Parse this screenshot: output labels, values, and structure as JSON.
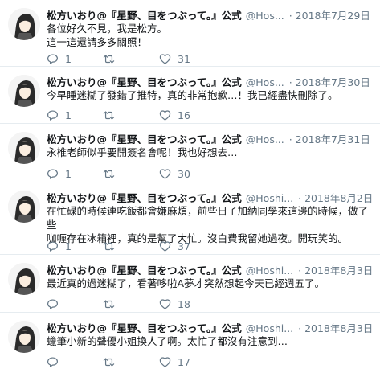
{
  "tweets": [
    {
      "name": "松方いおり@『星野、目をつぶって。』公式",
      "handle": "@Hos...",
      "date": "2018年7月29日",
      "lines": [
        "各位好久不見，我是松方。",
        "這一這還請多多關照！"
      ],
      "replies": "1",
      "retweets": "",
      "likes": "31"
    },
    {
      "name": "松方いおり@『星野、目をつぶって。』公式",
      "handle": "@Hos...",
      "date": "2018年7月30日",
      "lines": [
        "今早睡迷糊了發錯了推特，真的非常抱歉…！我已經盡快刪除了。"
      ],
      "replies": "1",
      "retweets": "",
      "likes": "16"
    },
    {
      "name": "松方いおり@『星野、目をつぶって。』公式",
      "handle": "@Hos...",
      "date": "2018年7月31日",
      "lines": [
        "永椎老師似乎要開簽名會呢！我也好想去…"
      ],
      "replies": "1",
      "retweets": "",
      "likes": "30"
    },
    {
      "name": "松方いおり@『星野、目をつぶって。』公式",
      "handle": "@Hoshi...",
      "date": "2018年8月2日",
      "lines": [
        "在忙碌的時候連吃飯都會嫌麻煩，前些日子加納同學來這邊的時候，做了些",
        "咖喱存在冰箱裡，真的是幫了大忙。沒白費我留她過夜。開玩笑的。"
      ],
      "replies": "1",
      "retweets": "",
      "likes": "37"
    },
    {
      "name": "松方いおり@『星野、目をつぶって。』公式",
      "handle": "@Hoshi...",
      "date": "2018年8月3日",
      "lines": [
        "最近真的過迷糊了，看著哆啦A夢才突然想起今天已經週五了。"
      ],
      "replies": "",
      "retweets": "",
      "likes": "18"
    },
    {
      "name": "松方いおり@『星野、目をつぶって。』公式",
      "handle": "@Hoshi...",
      "date": "2018年8月3日",
      "lines": [
        "蠟筆小新的聲優小姐換人了啊。太忙了都沒有注意到…"
      ],
      "replies": "",
      "retweets": "",
      "likes": "17"
    }
  ],
  "icons": {
    "reply": "reply-icon",
    "retweet": "retweet-icon",
    "like": "heart-icon"
  },
  "colors": {
    "text": "#14171a",
    "secondary": "#657786",
    "divider": "#e6ecf0"
  }
}
